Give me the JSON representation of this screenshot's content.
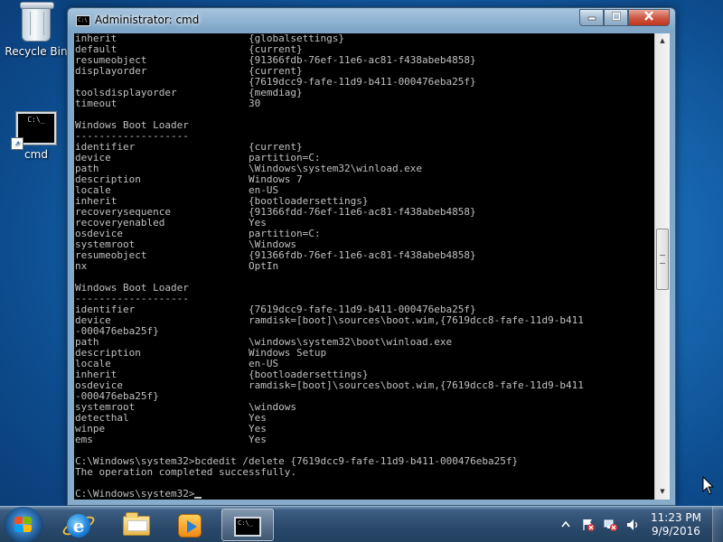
{
  "desktop": {
    "icons": [
      {
        "label": "Recycle Bin",
        "icon": "recycle-bin-icon"
      },
      {
        "label": "cmd",
        "icon": "cmd-shortcut-icon"
      }
    ]
  },
  "window": {
    "title": "Administrator: cmd",
    "icon": "cmd-icon",
    "console_lines": [
      {
        "k": "inherit",
        "v": "{globalsettings}"
      },
      {
        "k": "default",
        "v": "{current}"
      },
      {
        "k": "resumeobject",
        "v": "{91366fdb-76ef-11e6-ac81-f438abeb4858}"
      },
      {
        "k": "displayorder",
        "v": "{current}"
      },
      {
        "k": "",
        "v": "{7619dcc9-fafe-11d9-b411-000476eba25f}"
      },
      {
        "k": "toolsdisplayorder",
        "v": "{memdiag}"
      },
      {
        "k": "timeout",
        "v": "30"
      },
      {
        "t": ""
      },
      {
        "t": "Windows Boot Loader"
      },
      {
        "t": "-------------------"
      },
      {
        "k": "identifier",
        "v": "{current}"
      },
      {
        "k": "device",
        "v": "partition=C:"
      },
      {
        "k": "path",
        "v": "\\Windows\\system32\\winload.exe"
      },
      {
        "k": "description",
        "v": "Windows 7"
      },
      {
        "k": "locale",
        "v": "en-US"
      },
      {
        "k": "inherit",
        "v": "{bootloadersettings}"
      },
      {
        "k": "recoverysequence",
        "v": "{91366fdd-76ef-11e6-ac81-f438abeb4858}"
      },
      {
        "k": "recoveryenabled",
        "v": "Yes"
      },
      {
        "k": "osdevice",
        "v": "partition=C:"
      },
      {
        "k": "systemroot",
        "v": "\\Windows"
      },
      {
        "k": "resumeobject",
        "v": "{91366fdb-76ef-11e6-ac81-f438abeb4858}"
      },
      {
        "k": "nx",
        "v": "OptIn"
      },
      {
        "t": ""
      },
      {
        "t": "Windows Boot Loader"
      },
      {
        "t": "-------------------"
      },
      {
        "k": "identifier",
        "v": "{7619dcc9-fafe-11d9-b411-000476eba25f}"
      },
      {
        "k": "device",
        "v": "ramdisk=[boot]\\sources\\boot.wim,{7619dcc8-fafe-11d9-b411"
      },
      {
        "t": "-000476eba25f}"
      },
      {
        "k": "path",
        "v": "\\windows\\system32\\boot\\winload.exe"
      },
      {
        "k": "description",
        "v": "Windows Setup"
      },
      {
        "k": "locale",
        "v": "en-US"
      },
      {
        "k": "inherit",
        "v": "{bootloadersettings}"
      },
      {
        "k": "osdevice",
        "v": "ramdisk=[boot]\\sources\\boot.wim,{7619dcc8-fafe-11d9-b411"
      },
      {
        "t": "-000476eba25f}"
      },
      {
        "k": "systemroot",
        "v": "\\windows"
      },
      {
        "k": "detecthal",
        "v": "Yes"
      },
      {
        "k": "winpe",
        "v": "Yes"
      },
      {
        "k": "ems",
        "v": "Yes"
      },
      {
        "t": ""
      },
      {
        "t": "C:\\Windows\\system32>bcdedit /delete {7619dcc9-fafe-11d9-b411-000476eba25f}"
      },
      {
        "t": "The operation completed successfully."
      },
      {
        "t": ""
      },
      {
        "t": "C:\\Windows\\system32>",
        "cursor": true
      }
    ]
  },
  "taskbar": {
    "start_icon": "windows-start-orb",
    "pinned": [
      {
        "name": "internet-explorer-icon"
      },
      {
        "name": "windows-explorer-icon"
      },
      {
        "name": "windows-media-player-icon"
      },
      {
        "name": "cmd-taskbar-icon",
        "active": true
      }
    ],
    "tray": {
      "time": "11:23 PM",
      "date": "9/9/2016"
    }
  }
}
